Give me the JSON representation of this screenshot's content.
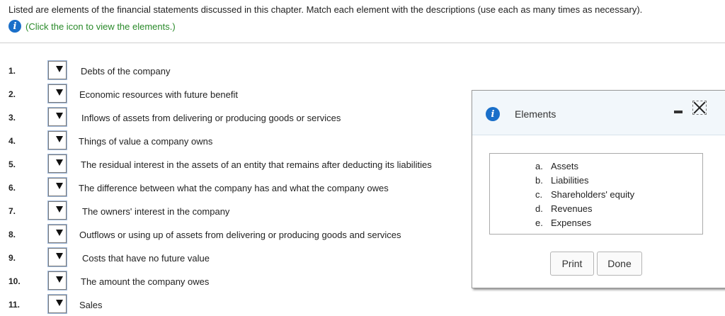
{
  "instructions": "Listed are elements of the financial statements discussed in this chapter. Match each element with the descriptions (use each as many times as necessary).",
  "info_link": "(Click the icon to view the elements.)",
  "info_icon_glyph": "i",
  "items": [
    {
      "num": "1.",
      "desc": "Debts of the company"
    },
    {
      "num": "2.",
      "desc": "Economic resources with future benefit"
    },
    {
      "num": "3.",
      "desc": "Inflows of assets from delivering or producing goods or services"
    },
    {
      "num": "4.",
      "desc": "Things of value a company owns"
    },
    {
      "num": "5.",
      "desc": "The residual interest in the assets of an entity that remains after deducting its liabilities"
    },
    {
      "num": "6.",
      "desc": "The difference between what the company has and what the company owes"
    },
    {
      "num": "7.",
      "desc": "The owners' interest in the company"
    },
    {
      "num": "8.",
      "desc": "Outflows or using up of assets from delivering or producing goods and services"
    },
    {
      "num": "9.",
      "desc": "Costs that have no future value"
    },
    {
      "num": "10.",
      "desc": "The amount the company owes"
    },
    {
      "num": "11.",
      "desc": "Sales"
    }
  ],
  "dialog": {
    "title": "Elements",
    "elements": [
      {
        "letter": "a.",
        "name": "Assets"
      },
      {
        "letter": "b.",
        "name": "Liabilities"
      },
      {
        "letter": "c.",
        "name": "Shareholders' equity"
      },
      {
        "letter": "d.",
        "name": "Revenues"
      },
      {
        "letter": "e.",
        "name": "Expenses"
      }
    ],
    "print_label": "Print",
    "done_label": "Done"
  },
  "colors": {
    "info_icon": "#1a6fc9",
    "link": "#2a8a2a"
  }
}
